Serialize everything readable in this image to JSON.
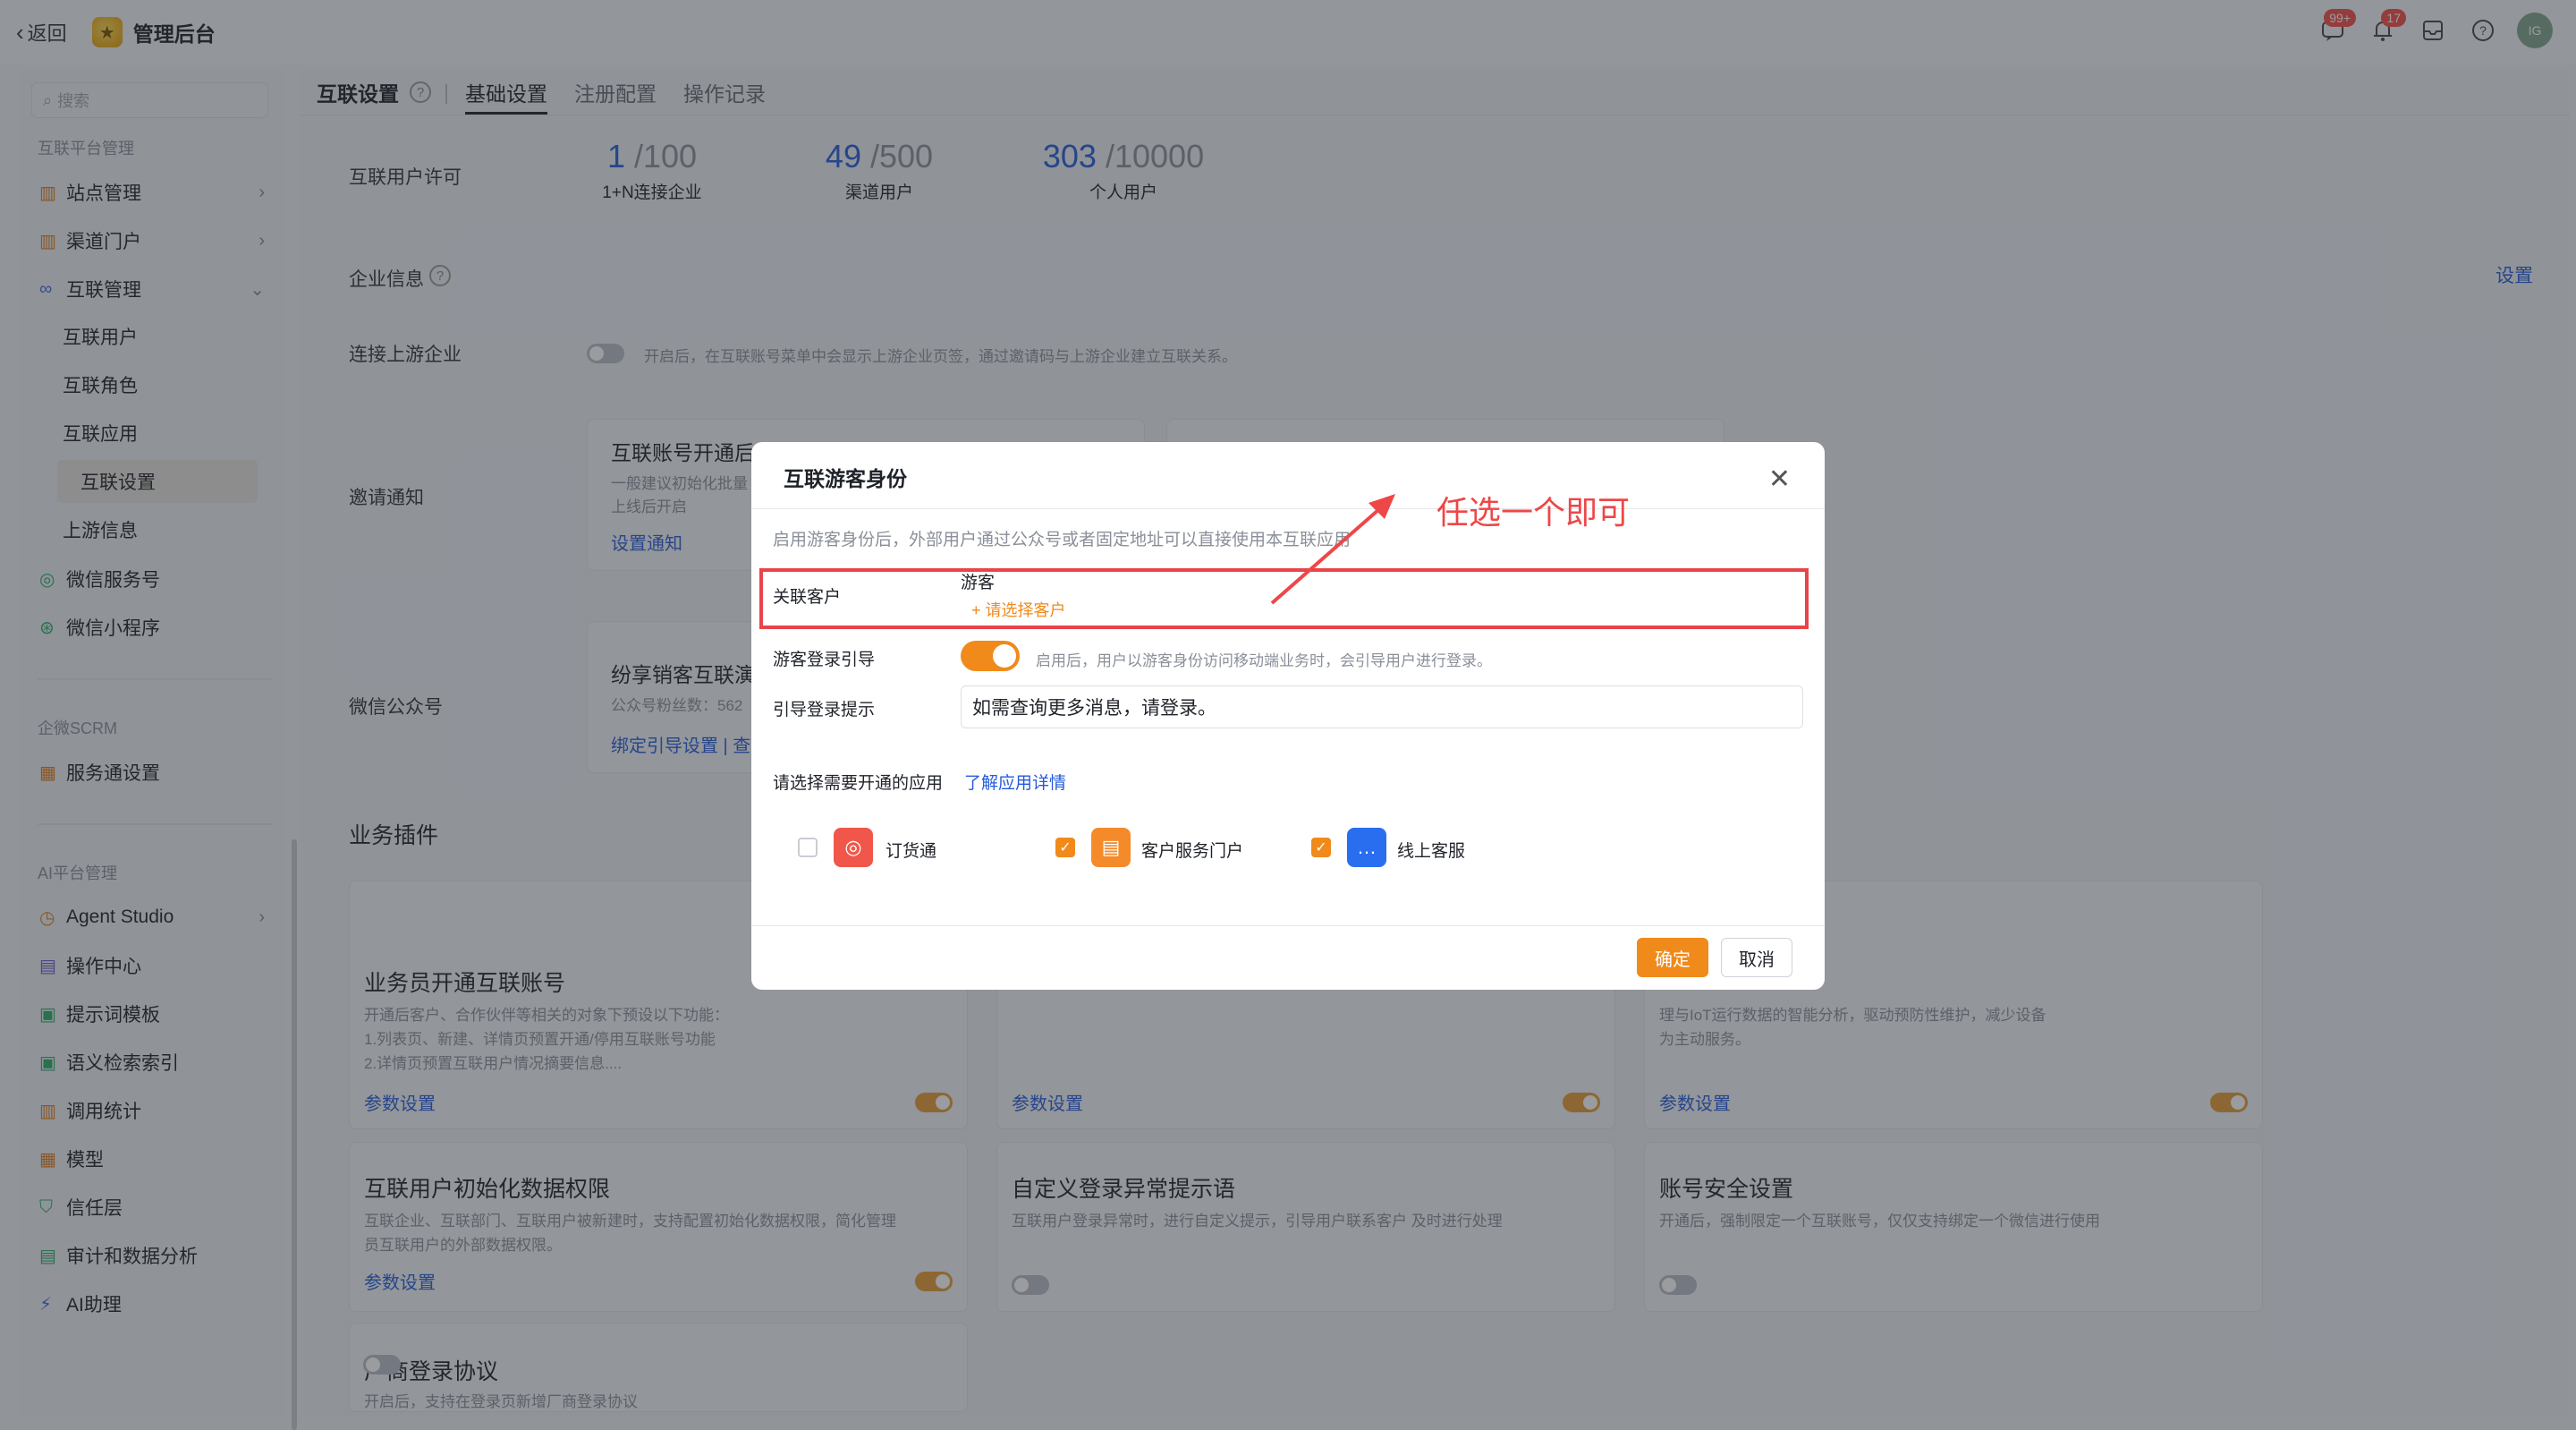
{
  "topbar": {
    "back_label": "返回",
    "app_title": "管理后台",
    "msg_badge": "99+",
    "bell_badge": "17",
    "avatar_text": "IG"
  },
  "sidebar": {
    "search_placeholder": "搜索",
    "sections": [
      {
        "title": "互联平台管理"
      },
      {
        "title": "企微SCRM"
      },
      {
        "title": "AI平台管理"
      }
    ],
    "items": [
      {
        "label": "站点管理"
      },
      {
        "label": "渠道门户"
      },
      {
        "label": "互联管理"
      },
      {
        "label": "互联用户"
      },
      {
        "label": "互联角色"
      },
      {
        "label": "互联应用"
      },
      {
        "label": "互联设置"
      },
      {
        "label": "上游信息"
      },
      {
        "label": "微信服务号"
      },
      {
        "label": "微信小程序"
      },
      {
        "label": "服务通设置"
      },
      {
        "label": "Agent Studio"
      },
      {
        "label": "操作中心"
      },
      {
        "label": "提示词模板"
      },
      {
        "label": "语义检索索引"
      },
      {
        "label": "调用统计"
      },
      {
        "label": "模型"
      },
      {
        "label": "信任层"
      },
      {
        "label": "审计和数据分析"
      },
      {
        "label": "AI助理"
      }
    ],
    "collapse_label": "«"
  },
  "header": {
    "title": "互联设置",
    "tabs": [
      {
        "label": "基础设置"
      },
      {
        "label": "注册配置"
      },
      {
        "label": "操作记录"
      }
    ]
  },
  "settings": {
    "license_label": "互联用户许可",
    "licenses": [
      {
        "used": "1",
        "total": "/100",
        "label": "1+N连接企业"
      },
      {
        "used": "49",
        "total": "/500",
        "label": "渠道用户"
      },
      {
        "used": "303",
        "total": "/10000",
        "label": "个人用户"
      }
    ],
    "enterprise_info_label": "企业信息",
    "setting_link": "设置",
    "upstream_label": "连接上游企业",
    "upstream_hint": "开启后，在互联账号菜单中会显示上游企业页签，通过邀请码与上游企业建立互联关系。",
    "invite_label": "邀请通知",
    "invite_card_title": "互联账号开通后",
    "invite_card_desc1": "一般建议初始化批量",
    "invite_card_desc2": "上线后开启",
    "invite_card_link": "设置通知",
    "wechat_label": "微信公众号",
    "wechat_card_title": "纷享销客互联演示",
    "wechat_card_desc": "公众号粉丝数：562",
    "wechat_card_link": "绑定引导设置 | 查"
  },
  "plugins": {
    "heading": "业务插件",
    "items": [
      {
        "title": "业务员开通互联账号",
        "desc1": "开通后客户、合作伙伴等相关的对象下预设以下功能：",
        "desc2": "1.列表页、新建、详情页预置开通/停用互联账号功能",
        "desc3": "2.详情页预置互联用户情况摘要信息....",
        "link": "参数设置",
        "on": true
      },
      {
        "title": "",
        "desc1": "",
        "link": "参数设置",
        "on": true
      },
      {
        "title": "",
        "desc1": "理与IoT运行数据的智能分析，驱动预防性维护，减少设备",
        "desc2": "为主动服务。",
        "link": "参数设置",
        "on": true
      },
      {
        "title": "互联用户初始化数据权限",
        "desc1": "互联企业、互联部门、互联用户被新建时，支持配置初始化数据权限，简化管理",
        "desc2": "员互联用户的外部数据权限。",
        "link": "参数设置",
        "on": true
      },
      {
        "title": "自定义登录异常提示语",
        "desc1": "互联用户登录异常时，进行自定义提示，引导用户联系客户 及时进行处理",
        "on": false
      },
      {
        "title": "账号安全设置",
        "desc1": "开通后，强制限定一个互联账号，仅仅支持绑定一个微信进行使用",
        "on": false
      },
      {
        "title": "厂商登录协议",
        "desc1": "开启后，支持在登录页新增厂商登录协议",
        "on": false
      }
    ]
  },
  "modal": {
    "title": "互联游客身份",
    "description": "启用游客身份后，外部用户通过公众号或者固定地址可以直接使用本互联应用",
    "customer_label": "关联客户",
    "customer_value": "游客",
    "customer_add": "+ 请选择客户",
    "guide_label": "游客登录引导",
    "guide_hint": "启用后，用户以游客身份访问移动端业务时，会引导用户进行登录。",
    "prompt_label": "引导登录提示",
    "prompt_value": "如需查询更多消息，请登录。",
    "apps_label": "请选择需要开通的应用",
    "apps_link": "了解应用详情",
    "apps": [
      {
        "name": "订货通",
        "checked": false,
        "color": "#f0574a"
      },
      {
        "name": "客户服务门户",
        "checked": true,
        "color": "#f58a2a"
      },
      {
        "name": "线上客服",
        "checked": true,
        "color": "#2a6ef0"
      }
    ],
    "ok_label": "确定",
    "cancel_label": "取消"
  },
  "annotation": {
    "text": "任选一个即可"
  }
}
